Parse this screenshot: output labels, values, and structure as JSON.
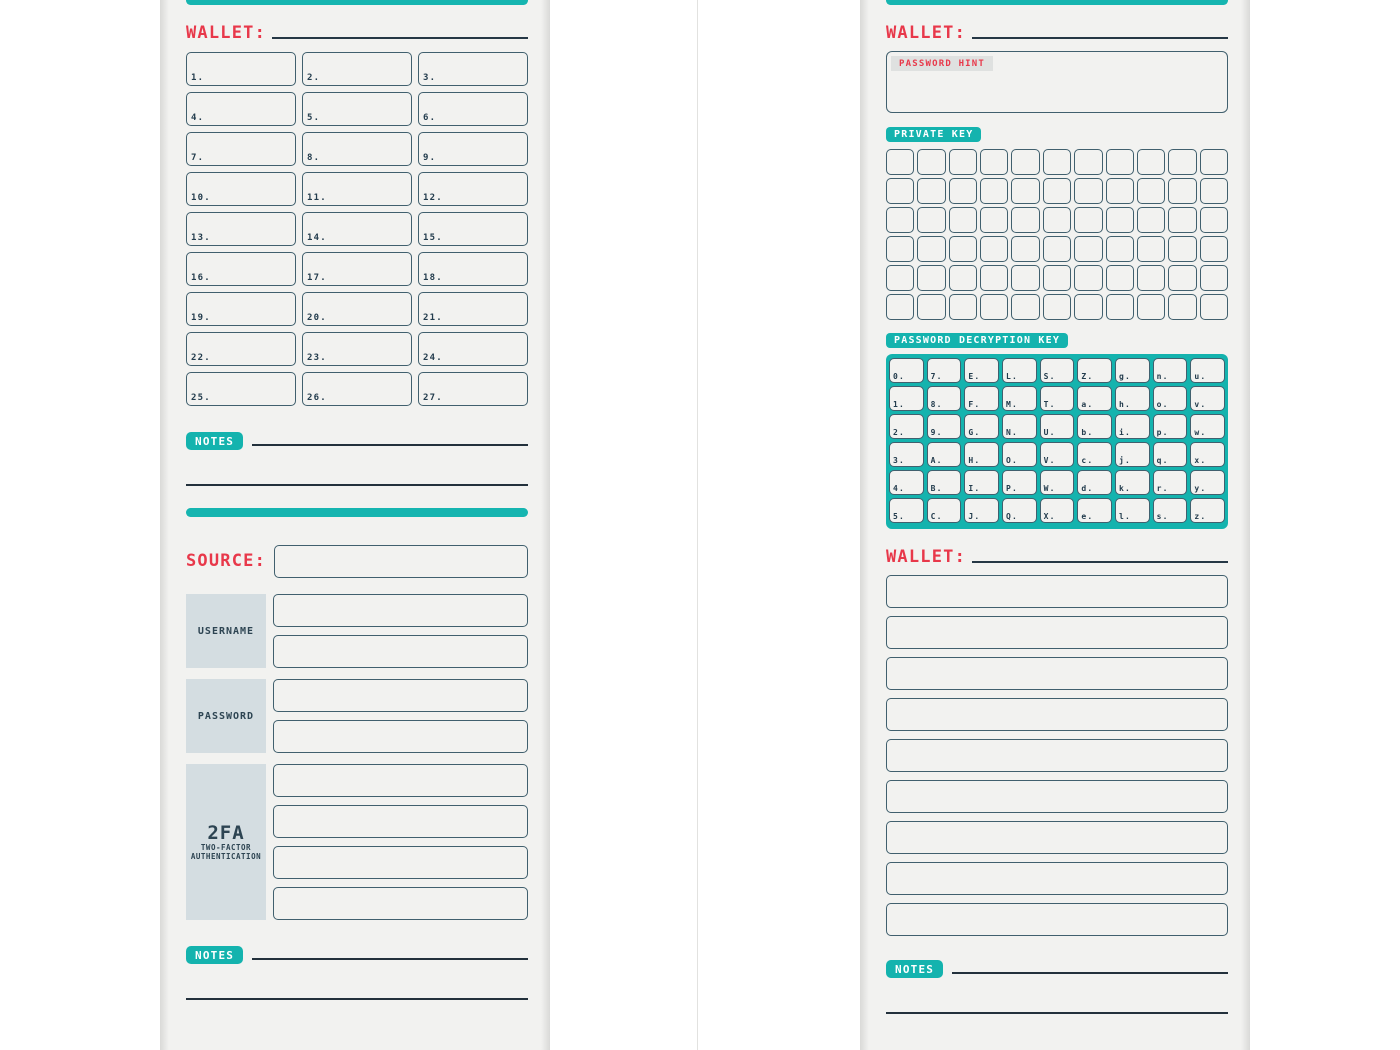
{
  "document": {
    "type": "crypto-wallet-password-log-book",
    "background_color": "#ffffff",
    "paper_color": "#f2f2f0",
    "accent_teal": "#14b3ae",
    "accent_red": "#e8384a",
    "ink_navy": "#23313c",
    "box_border": "#41606e",
    "label_fill": "#d4dde1"
  },
  "left_page": {
    "top_rule": "",
    "wallet_section": {
      "heading": "WALLET:",
      "cells": [
        "1.",
        "2.",
        "3.",
        "4.",
        "5.",
        "6.",
        "7.",
        "8.",
        "9.",
        "10.",
        "11.",
        "12.",
        "13.",
        "14.",
        "15.",
        "16.",
        "17.",
        "18.",
        "19.",
        "20.",
        "21.",
        "22.",
        "23.",
        "24.",
        "25.",
        "26.",
        "27."
      ],
      "cell_count": 27,
      "columns": 3,
      "rows": 9
    },
    "notes_section": {
      "label": "NOTES",
      "line_count": 2
    },
    "source_section": {
      "heading": "SOURCE:",
      "credentials": [
        {
          "label": "USERNAME",
          "label_lines": [
            "USERNAME"
          ],
          "field_count": 2
        },
        {
          "label": "PASSWORD",
          "label_lines": [
            "PASSWORD"
          ],
          "field_count": 2
        },
        {
          "label": "2FA",
          "label_lines": [
            "2FA",
            "TWO-FACTOR",
            "AUTHENTICATION"
          ],
          "field_count": 4
        }
      ]
    },
    "bottom_notes_section": {
      "label": "NOTES",
      "line_count": 2
    }
  },
  "right_page": {
    "wallet_hint_section": {
      "heading": "WALLET:",
      "hint_label": "PASSWORD HINT"
    },
    "private_key_section": {
      "label": "PRIVATE KEY",
      "columns": 11,
      "rows": 6,
      "cell_count": 66
    },
    "decryption_key_section": {
      "label": "PASSWORD DECRYPTION KEY",
      "columns": 9,
      "rows": 6,
      "characters": [
        "0.",
        "7.",
        "E.",
        "L.",
        "S.",
        "Z.",
        "g.",
        "n.",
        "u.",
        "1.",
        "8.",
        "F.",
        "M.",
        "T.",
        "a.",
        "h.",
        "o.",
        "v.",
        "2.",
        "9.",
        "G.",
        "N.",
        "U.",
        "b.",
        "i.",
        "p.",
        "w.",
        "3.",
        "A.",
        "H.",
        "O.",
        "V.",
        "c.",
        "j.",
        "q.",
        "x.",
        "4.",
        "B.",
        "I.",
        "P.",
        "W.",
        "d.",
        "k.",
        "r.",
        "y.",
        "5.",
        "C.",
        "J.",
        "Q.",
        "X.",
        "e.",
        "l.",
        "s.",
        "z."
      ]
    },
    "wallet_list_section": {
      "heading": "WALLET:",
      "row_count": 9
    },
    "notes_section": {
      "label": "NOTES",
      "line_count": 2
    }
  }
}
